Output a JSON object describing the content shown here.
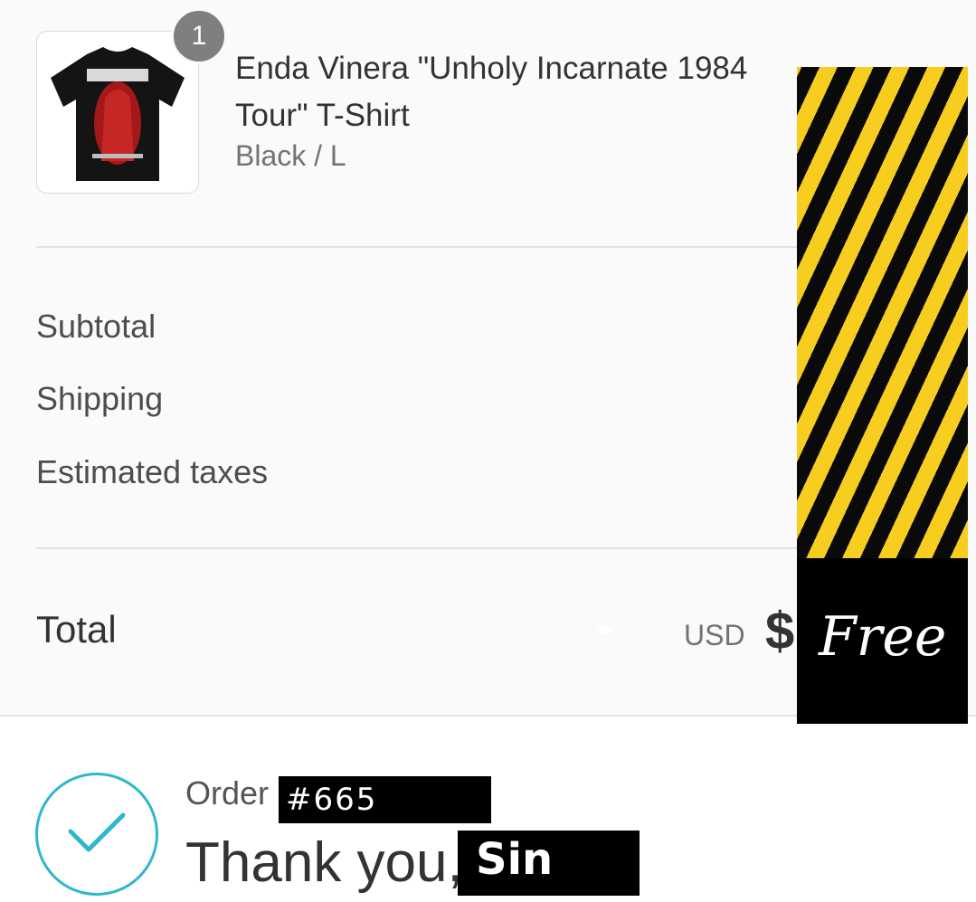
{
  "product": {
    "quantity": "1",
    "name": "Enda Vinera \"Unholy Incarnate 1984 Tour\" T-Shirt",
    "variant": "Black / L",
    "image_alt": "Enda Vinera Unholy Incarnate T-shirt"
  },
  "summary": {
    "subtotal_label": "Subtotal",
    "shipping_label": "Shipping",
    "taxes_label": "Estimated taxes",
    "total_label": "Total",
    "currency": "USD",
    "total_symbol": "$",
    "total_value": "Free"
  },
  "order": {
    "label": "Order",
    "number": "#665",
    "thanks": "Thank you,",
    "customer_name": "Sin"
  },
  "colors": {
    "accent": "#2eb8cc",
    "badge": "#7f7f7f",
    "hazard_yellow": "#f7cd1f"
  }
}
